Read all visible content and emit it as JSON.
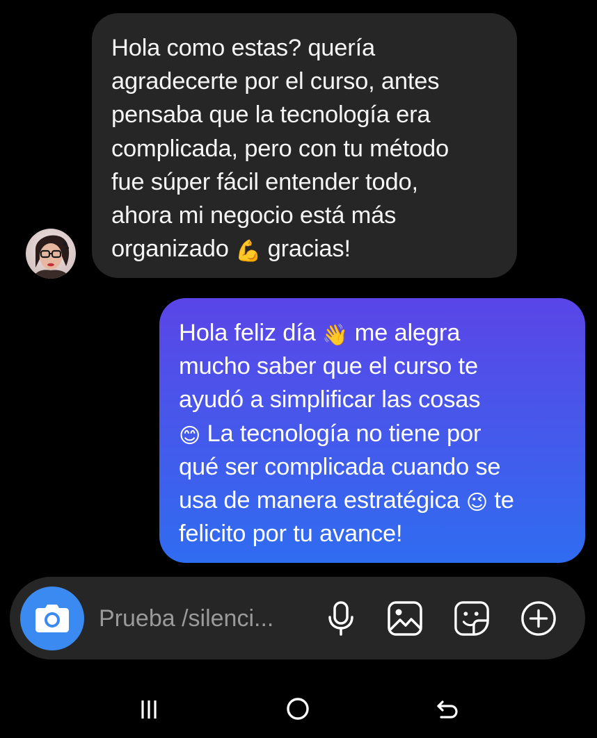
{
  "thread": {
    "incoming": {
      "text": "Hola como estas? quería\nagradecerte por el curso, antes\npensaba que la tecnología era\ncomplicada, pero con tu método\nfue súper fácil entender todo,\nahora mi negocio está más\norganizado",
      "emoji": "💪",
      "text_end": " gracias!"
    },
    "outgoing": {
      "line_1": "Hola feliz día ",
      "emoji_1": "👋",
      "line_1_end": " me alegra\nmucho saber que el curso te\nayudó a simplificar las cosas\n",
      "emoji_2": "😊",
      "line_2": " La tecnología no tiene por\nqué ser complicada cuando se\nusa de manera estratégica ",
      "emoji_3": "😉",
      "line_2_end": " te\nfelicito por tu avance!"
    }
  },
  "composer": {
    "placeholder": "Prueba /silenci..."
  },
  "icons": {
    "camera": "camera-icon",
    "microphone": "microphone-icon",
    "gallery": "gallery-icon",
    "sticker": "sticker-icon",
    "add": "add-circle-icon",
    "recents": "recents-icon",
    "home": "home-icon",
    "back": "back-icon"
  },
  "colors": {
    "background": "#000000",
    "incoming_bubble": "#262626",
    "outgoing_gradient_top": "#5a45e8",
    "outgoing_gradient_bottom": "#2f6cf0",
    "camera_button": "#3b8af2",
    "placeholder_text": "#9a9a9a"
  }
}
